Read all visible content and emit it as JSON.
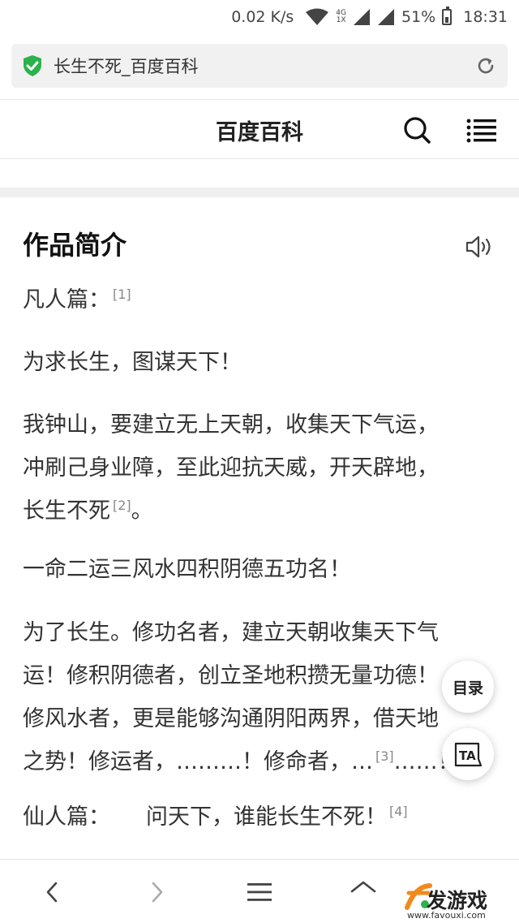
{
  "status_bar": {
    "net_speed": "0.02 K/s",
    "signal_label_top": "4G",
    "signal_label_bottom": "1X",
    "battery": "51%",
    "time": "18:31",
    "battery_level": 0.51
  },
  "url_bar": {
    "page_title": "长生不死_百度百科",
    "secure_icon": "shield-check-icon",
    "refresh_icon": "refresh-icon"
  },
  "header": {
    "title": "百度百科",
    "search_icon": "search-icon",
    "menu_icon": "menu-icon"
  },
  "article": {
    "section_title": "作品简介",
    "paragraphs": [
      {
        "text": "凡人篇：",
        "ref": "[1]"
      },
      {
        "text": "为求长生，图谋天下！"
      },
      {
        "line1": "我钟山，要建立无上天朝，收集天下气运，",
        "line2": "冲刷己身业障，至此迎抗天威，开天辟地，",
        "line3": "长生不死",
        "ref": "[2]",
        "tail": "。"
      },
      {
        "text": "一命二运三风水四积阴德五功名！"
      },
      {
        "line1": "为了长生。修功名者，建立天朝收集天下气",
        "line2": "运！修积阴德者，创立圣地积攒无量功德！",
        "line3": "修风水者，更是能够沟通阴阳两界，借天地",
        "line4a": "之势！修运者，………！修命者，…",
        "ref": "[3]",
        "line4b": "……！"
      },
      {
        "label": "仙人篇：",
        "text": "问天下，谁能长生不死！",
        "ref": "[4]"
      }
    ]
  },
  "floating": {
    "toc_label": "目录",
    "font_label": "TA"
  },
  "watermark": {
    "brand": "发游戏",
    "url": "www.favouxi.com"
  },
  "colors": {
    "accent_green": "#2bb24c",
    "watermark_orange": "#f08a1c"
  }
}
